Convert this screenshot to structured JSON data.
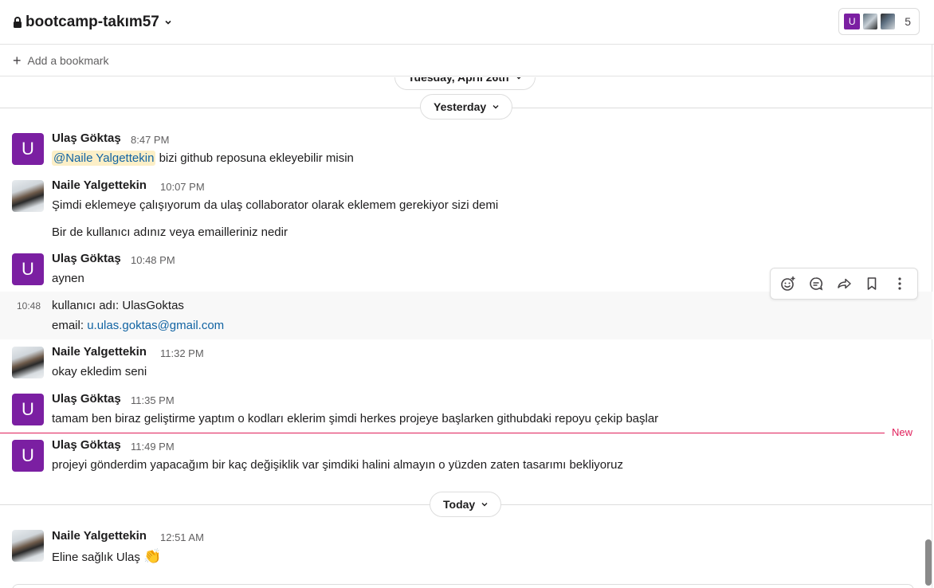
{
  "header": {
    "channel_name": "bootcamp-takım57",
    "member_avatar_letter": "U",
    "member_count": "5"
  },
  "bookmarks": {
    "add_label": "Add a bookmark"
  },
  "dates": {
    "partial": "Tuesday, April 26th",
    "yesterday": "Yesterday",
    "today": "Today"
  },
  "new_label": "New",
  "messages": [
    {
      "author": "Ulaş Göktaş",
      "avatar_letter": "U",
      "time": "8:47 PM",
      "mention": "@Naile Yalgettekin",
      "text": "bizi github reposuna ekleyebilir misin"
    },
    {
      "author": "Naile Yalgettekin",
      "time": "10:07 PM",
      "text": "Şimdi eklemeye çalışıyorum da ulaş collaborator olarak eklemem gerekiyor sizi demi",
      "text2": "Bir de kullanıcı adınız veya emailleriniz nedir"
    },
    {
      "author": "Ulaş Göktaş",
      "avatar_letter": "U",
      "time": "10:48 PM",
      "text": "aynen",
      "side_time": "10:48",
      "text2": "kullanıcı adı: UlasGoktas",
      "email_label": "email:",
      "email": "u.ulas.goktas@gmail.com"
    },
    {
      "author": "Naile Yalgettekin",
      "time": "11:32 PM",
      "text": "okay ekledim seni"
    },
    {
      "author": "Ulaş Göktaş",
      "avatar_letter": "U",
      "time": "11:35 PM",
      "text": "tamam ben biraz geliştirme yaptım o kodları eklerim şimdi herkes projeye başlarken githubdaki repoyu çekip başlar"
    },
    {
      "author": "Ulaş Göktaş",
      "avatar_letter": "U",
      "time": "11:49 PM",
      "text": "projeyi gönderdim yapacağım bir kaç değişiklik var şimdiki halini almayın o yüzden zaten tasarımı bekliyoruz"
    },
    {
      "author": "Naile Yalgettekin",
      "time": "12:51 AM",
      "text": "Eline sağlık Ulaş",
      "emoji": "👏"
    }
  ],
  "icons": {
    "lock": "lock-icon",
    "add_reaction": "add-reaction-icon",
    "reply_thread": "reply-in-thread-icon",
    "share": "share-icon",
    "bookmark": "bookmark-icon",
    "more": "more-actions-icon"
  },
  "colors": {
    "accent_purple": "#7b1fa2",
    "link": "#1264a3",
    "mention_bg": "#fcefc7",
    "new_red": "#e01e5a"
  }
}
